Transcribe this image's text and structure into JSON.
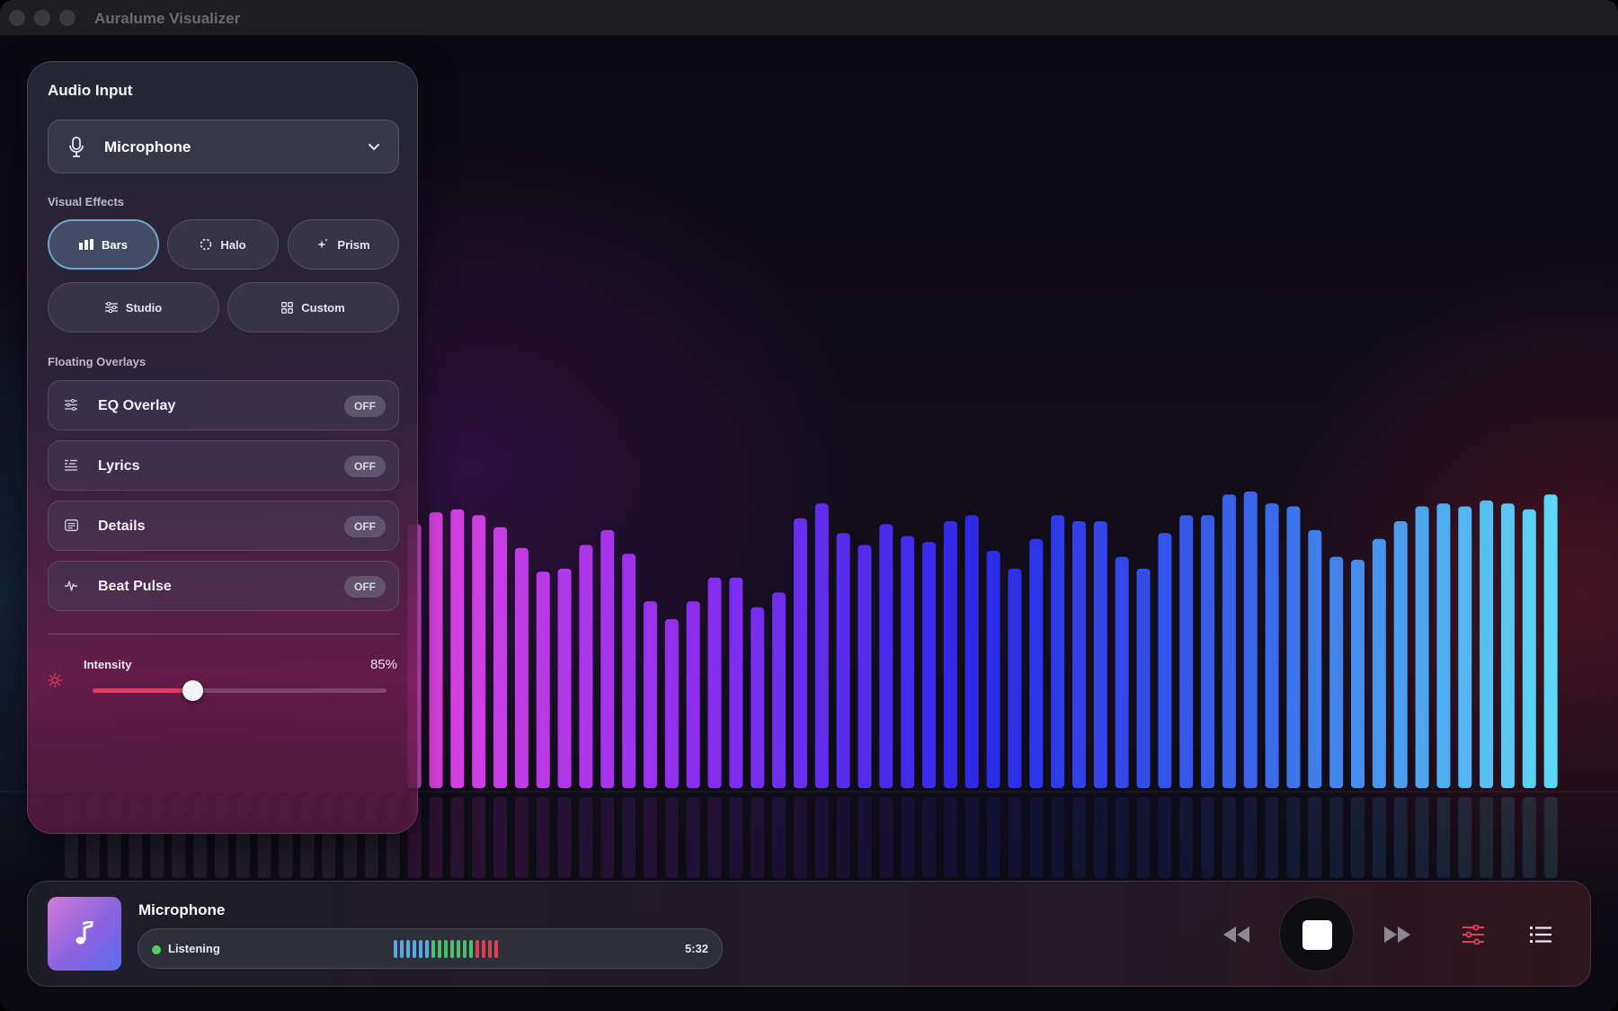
{
  "window": {
    "title": "Auralume Visualizer"
  },
  "panel": {
    "title": "Audio Input",
    "input_source": {
      "label": "Microphone",
      "icon": "microphone-icon"
    },
    "effects_label": "Visual Effects",
    "effects": [
      {
        "label": "Bars",
        "icon": "bars-icon",
        "active": true
      },
      {
        "label": "Halo",
        "icon": "halo-icon",
        "active": false
      },
      {
        "label": "Prism",
        "icon": "sparkle-icon",
        "active": false
      },
      {
        "label": "Studio",
        "icon": "sliders-icon",
        "active": false
      },
      {
        "label": "Custom",
        "icon": "grid-icon",
        "active": false
      }
    ],
    "overlays_label": "Floating Overlays",
    "overlays": [
      {
        "label": "EQ Overlay",
        "icon": "eq-icon",
        "state": "OFF"
      },
      {
        "label": "Lyrics",
        "icon": "lyrics-icon",
        "state": "OFF"
      },
      {
        "label": "Details",
        "icon": "details-icon",
        "state": "OFF"
      },
      {
        "label": "Beat Pulse",
        "icon": "pulse-icon",
        "state": "OFF"
      }
    ],
    "intensity": {
      "label": "Intensity",
      "value_text": "85%",
      "slider_fraction": 0.34,
      "accent": "#e23a5a"
    }
  },
  "player": {
    "title": "Microphone",
    "status": "Listening",
    "status_color": "#4cd15e",
    "time": "5:32",
    "meter_colors": [
      "#5aa8e0",
      "#5aa8e0",
      "#5aa8e0",
      "#5aa8e0",
      "#5aa8e0",
      "#5aa8e0",
      "#4cbf6a",
      "#4cbf6a",
      "#4cbf6a",
      "#4cbf6a",
      "#4cbf6a",
      "#4cbf6a",
      "#4cbf6a",
      "#d8414f",
      "#d8414f",
      "#d8414f",
      "#d8414f"
    ],
    "controls": [
      "rewind-icon",
      "stop-icon",
      "fast-forward-icon",
      "equalizer-icon",
      "playlist-icon"
    ],
    "accent": "#e23a5a"
  },
  "visualizer": {
    "levels": [
      0.1,
      0.1,
      0.1,
      0.1,
      0.1,
      0.1,
      0.1,
      0.1,
      0.1,
      0.1,
      0.1,
      0.1,
      0.1,
      0.1,
      0.1,
      0.1,
      0.89,
      0.93,
      0.94,
      0.92,
      0.88,
      0.81,
      0.73,
      0.74,
      0.82,
      0.87,
      0.79,
      0.63,
      0.57,
      0.63,
      0.71,
      0.71,
      0.61,
      0.66,
      0.91,
      0.96,
      0.86,
      0.82,
      0.89,
      0.85,
      0.83,
      0.9,
      0.92,
      0.8,
      0.74,
      0.84,
      0.92,
      0.9,
      0.9,
      0.78,
      0.74,
      0.86,
      0.92,
      0.92,
      0.99,
      1.0,
      0.96,
      0.95,
      0.87,
      0.78,
      0.77,
      0.84,
      0.9,
      0.95,
      0.96,
      0.95,
      0.97,
      0.96,
      0.94,
      0.99
    ],
    "gradient": [
      "#e042e0",
      "#8a2ef0",
      "#2a2ae8",
      "#3a6ae8",
      "#5ed6f5"
    ]
  }
}
